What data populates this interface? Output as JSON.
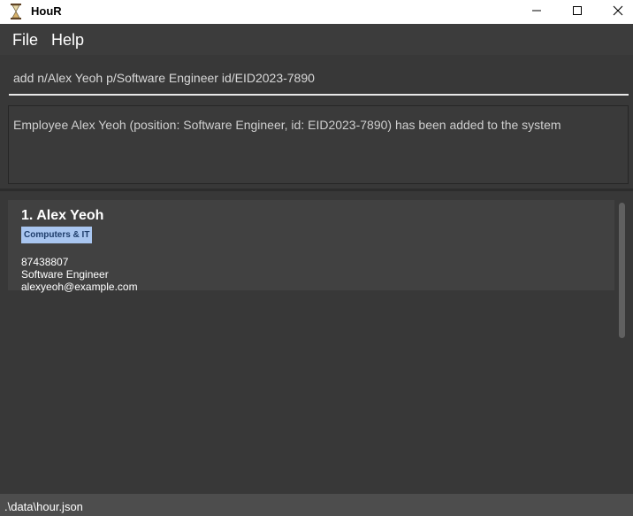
{
  "window": {
    "title": "HouR",
    "icon": "hourglass-icon",
    "controls": [
      "minimize-icon",
      "maximize-icon",
      "close-icon"
    ]
  },
  "menu": {
    "file": "File",
    "help": "Help"
  },
  "command": {
    "value": "add n/Alex Yeoh p/Software Engineer id/EID2023-7890"
  },
  "result": {
    "message": "Employee Alex Yeoh (position: Software Engineer, id: EID2023-7890) has been added to the system"
  },
  "employees": [
    {
      "index_name": "1.  Alex Yeoh",
      "tag": "Computers & IT",
      "phone": "87438807",
      "position": "Software Engineer",
      "email": "alexyeoh@example.com"
    }
  ],
  "status": {
    "file_path": ".\\data\\hour.json"
  },
  "colors": {
    "background": "#383838",
    "tag_background": "#a9c6f0",
    "card_background": "#414141"
  }
}
